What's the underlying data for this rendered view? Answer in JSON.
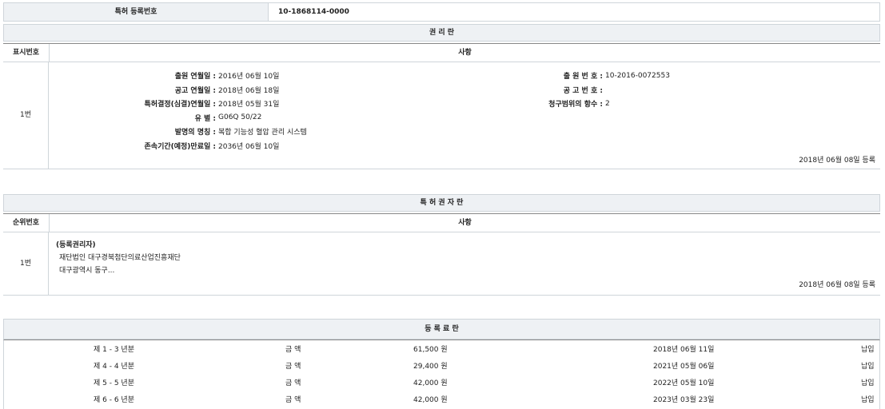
{
  "reg": {
    "label": "특허 등록번호",
    "value": "10-1868114-0000"
  },
  "rights": {
    "title": "권 리 란",
    "col_no": "표시번호",
    "col_item": "사항",
    "row_no": "1번",
    "left": [
      {
        "label": "출원 연월일 :",
        "value": "2016년 06월 10일"
      },
      {
        "label": "공고 연월일 :",
        "value": "2018년 06월 18일"
      },
      {
        "label": "특허결정(심결)연월일 :",
        "value": "2018년 05월 31일"
      },
      {
        "label": "유 별 :",
        "value": "G06Q 50/22"
      },
      {
        "label": "발명의 명칭 :",
        "value": "복합 기능성 혈압 관리 시스템"
      },
      {
        "label": "존속기간(예정)만료일 :",
        "value": "2036년 06월 10일"
      }
    ],
    "right": [
      {
        "label": "출 원 번 호 :",
        "value": "10-2016-0072553"
      },
      {
        "label": "공 고 번 호 :",
        "value": ""
      },
      {
        "label": "청구범위의 항수 :",
        "value": "2"
      }
    ],
    "reg_date": "2018년 06월 08일 등록"
  },
  "owner": {
    "title": "특 허 권 자 란",
    "col_no": "순위번호",
    "col_item": "사항",
    "row_no": "1번",
    "heading": "(등록권리자)",
    "name": "재단법인 대구경북첨단의료산업진흥재단",
    "address": "대구광역시 동구...",
    "reg_date": "2018년 06월 08일 등록"
  },
  "fees": {
    "title": "등 록 료 란",
    "rows": [
      {
        "period": "제 1 - 3 년분",
        "amount_label": "금 액",
        "amount": "61,500 원",
        "date": "2018년 06월 11일",
        "status": "납입"
      },
      {
        "period": "제 4 - 4 년분",
        "amount_label": "금 액",
        "amount": "29,400 원",
        "date": "2021년 05월 06일",
        "status": "납입"
      },
      {
        "period": "제 5 - 5 년분",
        "amount_label": "금 액",
        "amount": "42,000 원",
        "date": "2022년 05월 10일",
        "status": "납입"
      },
      {
        "period": "제 6 - 6 년분",
        "amount_label": "금 액",
        "amount": "42,000 원",
        "date": "2023년 03월 23일",
        "status": "납입"
      }
    ]
  }
}
